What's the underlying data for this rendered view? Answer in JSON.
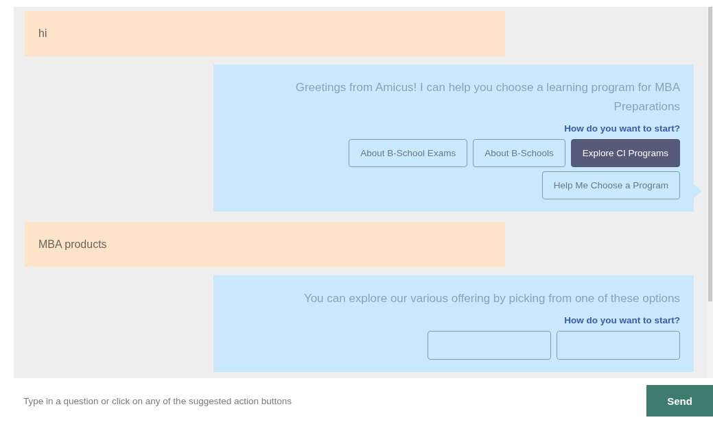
{
  "messages": [
    {
      "kind": "user",
      "text": "hi"
    },
    {
      "kind": "bot",
      "text": "Greetings from Amicus! I can help you choose a learning program for MBA Preparations",
      "prompt": "How do you want to start?",
      "buttons": [
        {
          "label": "About B-School Exams",
          "selected": false
        },
        {
          "label": "About B-Schools",
          "selected": false
        },
        {
          "label": "Explore CI Programs",
          "selected": true
        },
        {
          "label": "Help Me Choose a Program",
          "selected": false
        }
      ]
    },
    {
      "kind": "user",
      "text": "MBA products"
    },
    {
      "kind": "bot",
      "text": "You can explore our various offering by picking from one of these options",
      "prompt": "How do you want to start?",
      "buttons": [
        {
          "selected": false
        },
        {
          "selected": false
        }
      ]
    }
  ],
  "input": {
    "placeholder": "Type in a question or click on any of the suggested action buttons"
  },
  "send_button": "Send"
}
